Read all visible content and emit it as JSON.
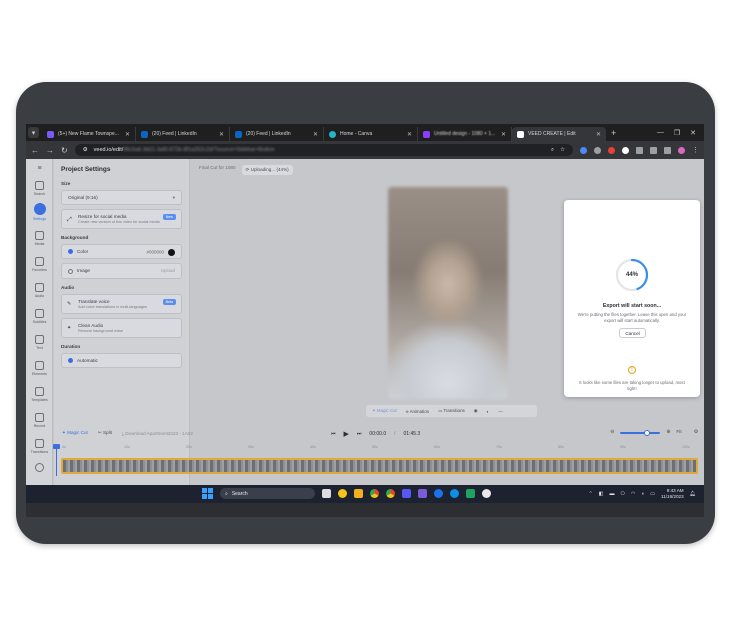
{
  "browser": {
    "tabs": [
      {
        "label": "(5+) New Flame Townspe...",
        "color": "#7a5af8"
      },
      {
        "label": "(20) Feed | LinkedIn",
        "color": "#0a66c2"
      },
      {
        "label": "(20) Feed | LinkedIn",
        "color": "#0a66c2"
      },
      {
        "label": "Home - Canva",
        "color": "#26b5c8"
      },
      {
        "label": "Untitled design - 1080 × 1...",
        "color": "#8b3dff"
      },
      {
        "label": "VEED CREATE | Edit",
        "color": "#ffffff"
      }
    ],
    "url": "veed.io/edit/",
    "url_rest": "96c5a6-9d11-3af0-872b-8f1a262c2d/?source=Sidebar+Button"
  },
  "rail": {
    "items": [
      "Search",
      "Settings",
      "Media",
      "Favorites",
      "Audio",
      "Subtitles",
      "Text",
      "Elements",
      "Templates",
      "Record",
      "Transitions"
    ]
  },
  "panel": {
    "title": "Project Settings",
    "size_label": "Size",
    "size_value": "Original (9:16)",
    "resize_title": "Resize for social media",
    "resize_desc": "Create new version of this video for social media",
    "new_badge": "New",
    "background_label": "Background",
    "color_label": "Color",
    "color_value": "#000000",
    "image_label": "Image",
    "image_upload": "Upload",
    "audio_label": "Audio",
    "translate_title": "Translate voice",
    "translate_desc": "Add voice translations in multi-languages",
    "beta_badge": "Beta",
    "clean_title": "Clean Audio",
    "clean_desc": "Remove background noise",
    "duration_label": "Duration",
    "automatic_label": "Automatic"
  },
  "canvas": {
    "project_name": "Final Cut for 1080",
    "uploading": "Uploading... (44%)",
    "tools": [
      "Magic Cut",
      "Animation",
      "Transitions"
    ]
  },
  "export_modal": {
    "progress": 44,
    "progress_label": "44%",
    "title": "Export will start soon...",
    "description": "We're putting the files together. Leave this open and your export will start automatically.",
    "cancel": "Cancel",
    "note": "It looks like some files are taking longer to upload, most tight!"
  },
  "timeline": {
    "magic_cut": "Magic Cut",
    "split": "Split",
    "download": "Download Apartment2023 - 1A02",
    "current_time": "00:00.0",
    "total_time": "01:45.3",
    "fit": "Fit",
    "ruler_ticks": [
      "0s",
      "10s",
      "20s",
      "30s",
      "40s",
      "50s",
      "60s",
      "70s",
      "80s",
      "90s",
      "100s"
    ]
  },
  "taskbar": {
    "search_placeholder": "Search",
    "time": "9:43 AM",
    "date": "11/16/2023",
    "app_colors": [
      "#3f8cff",
      "#f5c518",
      "#f2b01e",
      "#2fa84f",
      "#e94235",
      "#5558f7",
      "#7b5cd6",
      "#1a73e8",
      "#0e8ee9",
      "#1ea362",
      "#e8e8e8"
    ]
  },
  "colors": {
    "accent": "#3b6fe0",
    "warning": "#e0a21a",
    "track_border": "#e1a935"
  }
}
